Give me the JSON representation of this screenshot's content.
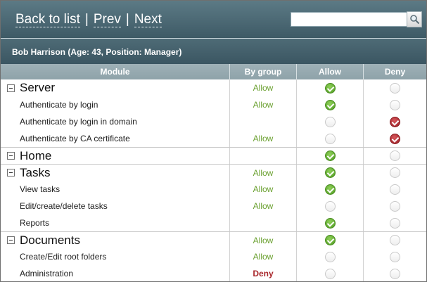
{
  "nav": {
    "back_label": "Back to list",
    "prev_label": "Prev",
    "next_label": "Next",
    "separator": "|"
  },
  "search": {
    "value": "",
    "icon": "search-icon"
  },
  "user": {
    "title": "Bob Harrison (Age: 43, Position: Manager)"
  },
  "table": {
    "headers": {
      "module": "Module",
      "by_group": "By group",
      "allow": "Allow",
      "deny": "Deny"
    },
    "rows": [
      {
        "label": "Server",
        "group": true,
        "by_group": "Allow",
        "state": "allow"
      },
      {
        "label": "Authenticate by login",
        "group": false,
        "by_group": "Allow",
        "state": "allow"
      },
      {
        "label": "Authenticate by login in domain",
        "group": false,
        "by_group": "",
        "state": "deny"
      },
      {
        "label": "Authenticate by CA certificate",
        "group": false,
        "by_group": "Allow",
        "state": "deny"
      },
      {
        "label": "Home",
        "group": true,
        "by_group": "",
        "state": "allow"
      },
      {
        "label": "Tasks",
        "group": true,
        "by_group": "Allow",
        "state": "allow"
      },
      {
        "label": "View tasks",
        "group": false,
        "by_group": "Allow",
        "state": "allow"
      },
      {
        "label": "Edit/create/delete tasks",
        "group": false,
        "by_group": "Allow",
        "state": "none"
      },
      {
        "label": "Reports",
        "group": false,
        "by_group": "",
        "state": "allow"
      },
      {
        "label": "Documents",
        "group": true,
        "by_group": "Allow",
        "state": "allow"
      },
      {
        "label": "Create/Edit root folders",
        "group": false,
        "by_group": "Allow",
        "state": "none"
      },
      {
        "label": "Administration",
        "group": false,
        "by_group": "Deny",
        "state": "none"
      }
    ]
  },
  "colors": {
    "allow_text": "#6aa02f",
    "deny_text": "#a9272b",
    "allow_radio": "#5aa82a",
    "deny_radio": "#a32328",
    "header_bg": "#4e6b76"
  }
}
